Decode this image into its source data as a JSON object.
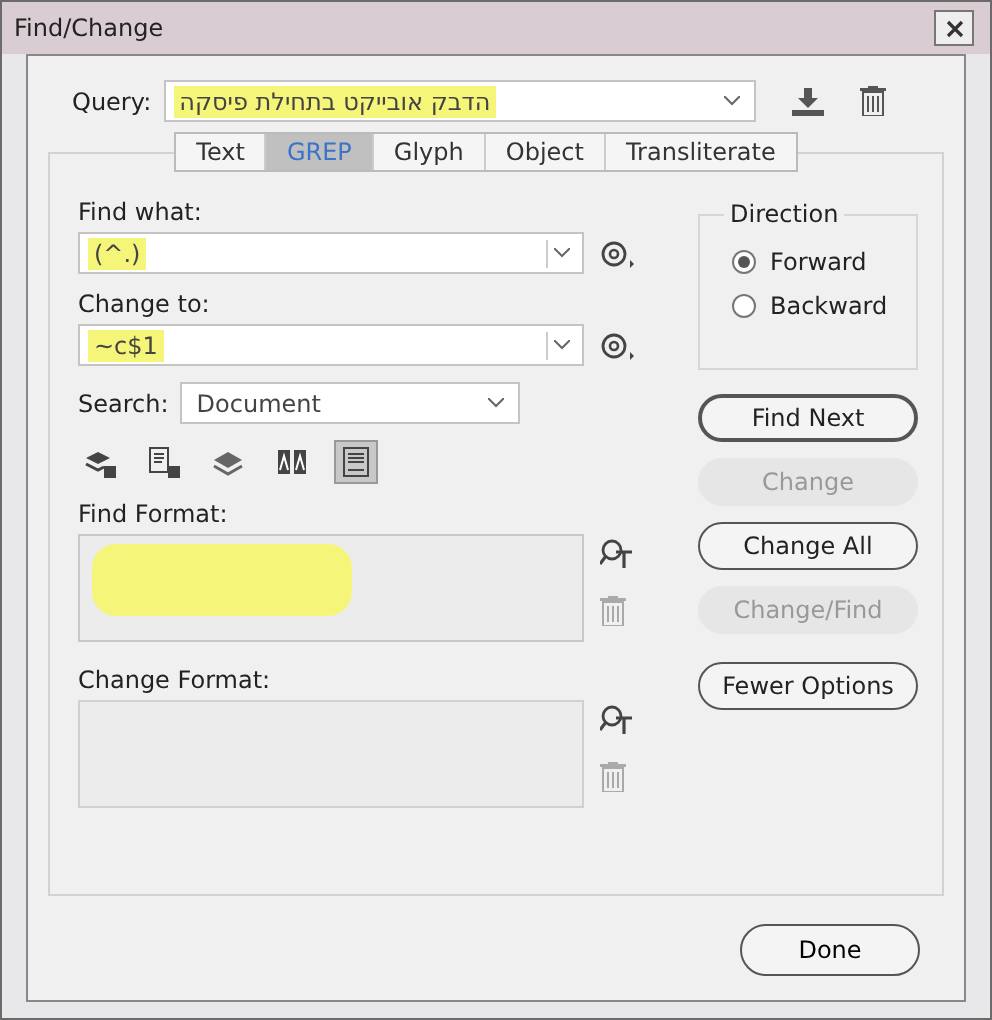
{
  "window": {
    "title": "Find/Change"
  },
  "query": {
    "label": "Query:",
    "value": "הדבק אובייקט בתחילת פיסקה",
    "highlighted": true
  },
  "tabs": [
    {
      "label": "Text",
      "selected": false
    },
    {
      "label": "GREP",
      "selected": true
    },
    {
      "label": "Glyph",
      "selected": false
    },
    {
      "label": "Object",
      "selected": false
    },
    {
      "label": "Transliterate",
      "selected": false
    }
  ],
  "find_what": {
    "label": "Find what:",
    "value": "(^.)",
    "highlighted": true
  },
  "change_to": {
    "label": "Change to:",
    "value": "~c$1",
    "highlighted": true
  },
  "search": {
    "label": "Search:",
    "value": "Document"
  },
  "option_toggles": [
    {
      "kind": "locked-layers",
      "selected": false
    },
    {
      "kind": "locked-stories",
      "selected": false
    },
    {
      "kind": "hidden-layers",
      "selected": false
    },
    {
      "kind": "master-pages",
      "selected": false
    },
    {
      "kind": "footnotes",
      "selected": true
    }
  ],
  "find_format": {
    "label": "Find Format:",
    "highlighted": true
  },
  "change_format": {
    "label": "Change Format:",
    "highlighted": false
  },
  "direction": {
    "title": "Direction",
    "options": [
      {
        "label": "Forward",
        "selected": true
      },
      {
        "label": "Backward",
        "selected": false
      }
    ]
  },
  "actions": [
    {
      "label": "Find Next",
      "disabled": false
    },
    {
      "label": "Change",
      "disabled": true
    },
    {
      "label": "Change All",
      "disabled": false
    },
    {
      "label": "Change/Find",
      "disabled": true
    },
    {
      "label": "Fewer Options",
      "disabled": false
    }
  ],
  "done_button": {
    "label": "Done"
  }
}
